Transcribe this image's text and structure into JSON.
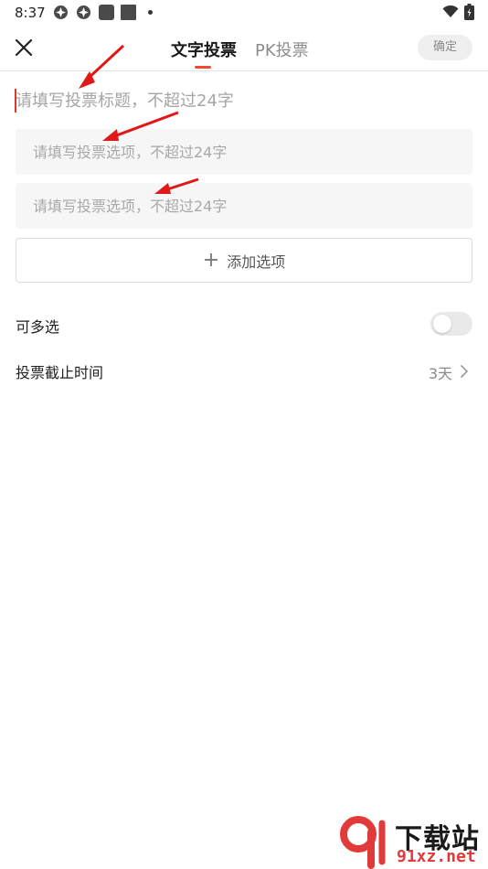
{
  "status_bar": {
    "time": "8:37",
    "icons": [
      "app-icon-1",
      "app-icon-2",
      "app-icon-3",
      "app-icon-4",
      "notification-dot",
      "wifi-icon",
      "battery-icon"
    ]
  },
  "header": {
    "close_icon": "close-icon",
    "tabs": [
      {
        "label": "文字投票",
        "active": true
      },
      {
        "label": "PK投票",
        "active": false
      }
    ],
    "confirm_label": "确定"
  },
  "form": {
    "title_placeholder": "请填写投票标题，不超过24字",
    "options": [
      {
        "placeholder": "请填写投票选项，不超过24字"
      },
      {
        "placeholder": "请填写投票选项，不超过24字"
      }
    ],
    "add_option_label": "添加选项"
  },
  "settings": {
    "multi_select_label": "可多选",
    "multi_select_enabled": false,
    "deadline_label": "投票截止时间",
    "deadline_value": "3天"
  },
  "watermark": {
    "title": "下载站",
    "url": "91xz.net"
  },
  "colors": {
    "accent": "#f04a35",
    "arrow": "#e01818",
    "input_bg": "#f6f6f6"
  }
}
